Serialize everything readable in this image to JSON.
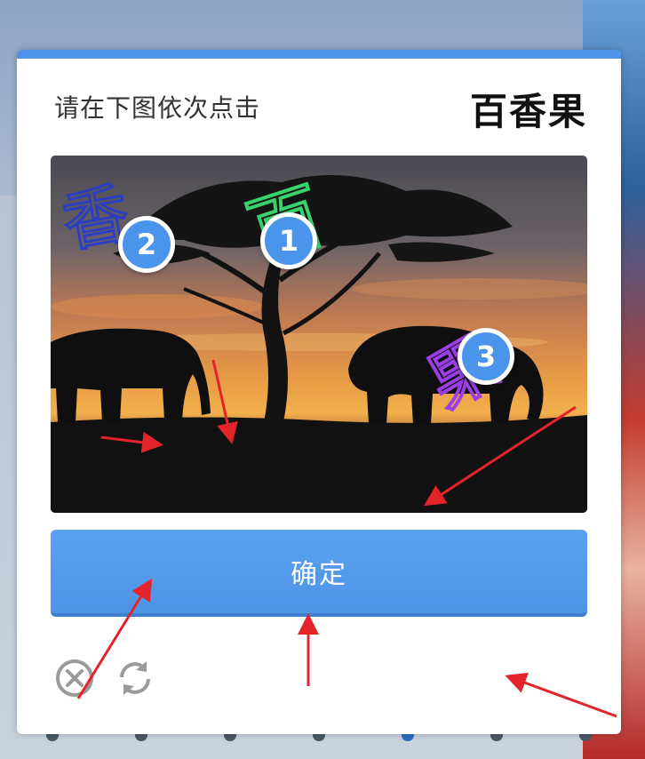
{
  "captcha": {
    "instruction": "请在下图依次点击",
    "target_chars": "百香果",
    "confirm_label": "确定",
    "markers": [
      "1",
      "2",
      "3"
    ],
    "scene_chars": [
      "百",
      "香",
      "果"
    ]
  },
  "icons": {
    "close": "close-circle-icon",
    "refresh": "refresh-icon"
  },
  "colors": {
    "accent": "#4f93e9",
    "marker": "#4a94ec",
    "arrow": "#e3242b"
  }
}
